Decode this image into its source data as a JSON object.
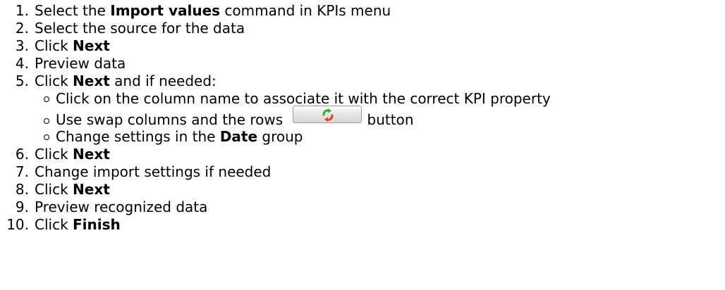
{
  "steps": [
    {
      "num": "1.",
      "pre": "Select the ",
      "bold": "Import values",
      "post": " command in KPIs menu"
    },
    {
      "num": "2.",
      "pre": "Select the source for the data"
    },
    {
      "num": "3.",
      "pre": "Click ",
      "bold": "Next"
    },
    {
      "num": "4.",
      "pre": "Preview data"
    },
    {
      "num": "5.",
      "pre": "Click ",
      "bold": "Next",
      "post": " and if needed:"
    },
    {
      "num": "6.",
      "pre": "Click ",
      "bold": "Next"
    },
    {
      "num": "7.",
      "pre": "Change import settings if needed"
    },
    {
      "num": "8.",
      "pre": "Click ",
      "bold": "Next"
    },
    {
      "num": "9.",
      "pre": "Preview recognized data"
    },
    {
      "num": "10.",
      "pre": "Click ",
      "bold": "Finish"
    }
  ],
  "substeps": [
    {
      "pre": "Click on the column name to associate it with the correct KPI property"
    },
    {
      "pre": "Use swap columns and the rows ",
      "post": "button"
    },
    {
      "pre": "Change settings in the ",
      "bold": "Date",
      "post": " group"
    }
  ],
  "icons": {
    "swap_button_icon": "swap-icon"
  },
  "colors": {
    "text": "#000000",
    "background": "#ffffff",
    "swap_green": "#3fa535",
    "swap_red": "#e2421e"
  }
}
